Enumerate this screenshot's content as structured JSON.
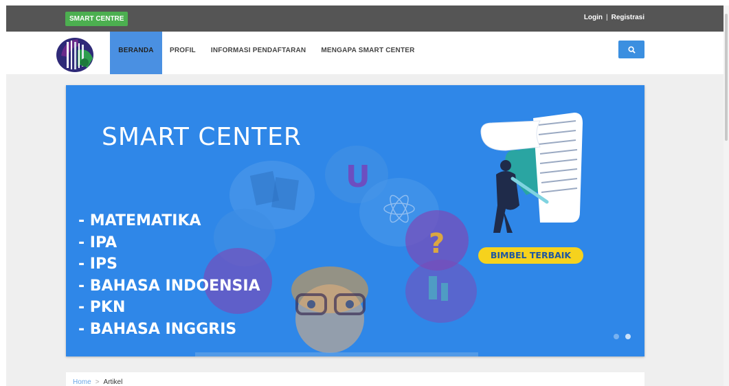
{
  "topbar": {
    "brand": "SMART CENTRE",
    "login": "Login",
    "separator": "|",
    "register": "Registrasi"
  },
  "nav": {
    "items": [
      {
        "label": "BERANDA",
        "active": true
      },
      {
        "label": "PROFIL",
        "active": false
      },
      {
        "label": "INFORMASI PENDAFTARAN",
        "active": false
      },
      {
        "label": "MENGAPA SMART CENTER",
        "active": false
      }
    ],
    "search_icon": "search-icon"
  },
  "hero": {
    "title": "SMART CENTER",
    "subjects": [
      "- MATEMATIKA",
      "- IPA",
      "- IPS",
      "- BAHASA INDOENSIA",
      "- PKN",
      "- BAHASA INGGRIS"
    ],
    "badge": "BIMBEL TERBAIK",
    "slides_total": 2,
    "slide_active": 2
  },
  "breadcrumb": {
    "home": "Home",
    "separator": ">",
    "current": "Artikel"
  },
  "colors": {
    "topbar": "#555555",
    "brand_green": "#4caf50",
    "active_nav": "#4a90e2",
    "hero_blue": "#2f87e8",
    "badge_yellow": "#f6d21d"
  }
}
